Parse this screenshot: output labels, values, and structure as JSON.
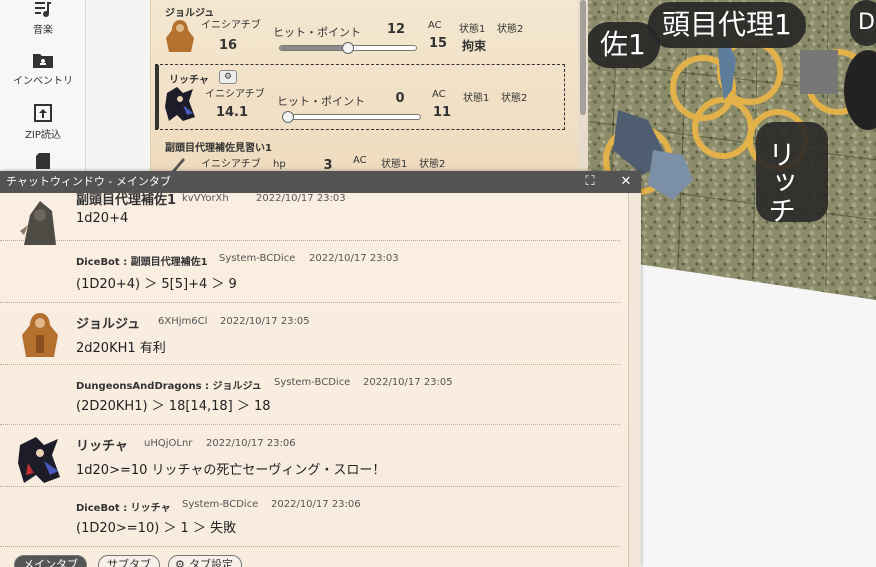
{
  "sidebar": {
    "items": [
      {
        "label": "音楽",
        "icon": "music-icon"
      },
      {
        "label": "インベントリ",
        "icon": "folder-icon"
      },
      {
        "label": "ZIP読込",
        "icon": "upload-icon"
      },
      {
        "label": "",
        "icon": "sd-card-icon"
      }
    ]
  },
  "table": {
    "token_labels": [
      "頭目代理1",
      "佐1",
      "D",
      "リッチ"
    ]
  },
  "charlist": {
    "characters": [
      {
        "name": "ジョルジュ",
        "init_label": "イニシアチブ",
        "init": "16",
        "hp_label": "ヒット・ポイント",
        "hp": "12",
        "ac_label": "AC",
        "ac": "15",
        "status1": "状態1",
        "status2": "状態2",
        "status_value": "拘束",
        "hp_ratio": 0.5
      },
      {
        "name": "リッチャ",
        "init_label": "イニシアチブ",
        "init": "14.1",
        "hp_label": "ヒット・ポイント",
        "hp": "0",
        "ac_label": "AC",
        "ac": "11",
        "status1": "状態1",
        "status2": "状態2",
        "status_value": "",
        "hp_ratio": 0
      },
      {
        "name": "副頭目代理補佐見習い1",
        "init_label": "イニシアチブ",
        "init": "",
        "hp_label": "hp",
        "hp": "3",
        "ac_label": "AC",
        "ac": "",
        "status1": "状態1",
        "status2": "状態2",
        "status_value": "",
        "hp_ratio": 0
      }
    ]
  },
  "chat": {
    "title": "チャットウィンドウ - メインタブ",
    "expand_icon": "⛶",
    "close_icon": "✕",
    "messages": [
      {
        "who": "副頭目代理補佐1",
        "id": "kvVYorXh",
        "time": "2022/10/17 23:03",
        "text": "1d20+4"
      },
      {
        "who": "DiceBot : 副頭目代理補佐1",
        "id": "System-BCDice",
        "time": "2022/10/17 23:03",
        "text": "(1D20+4) ＞ 5[5]+4 ＞ 9"
      },
      {
        "who": "ジョルジュ",
        "id": "6XHjm6Cl",
        "time": "2022/10/17 23:05",
        "text": "2d20KH1 有利"
      },
      {
        "who": "DungeonsAndDragons : ジョルジュ",
        "id": "System-BCDice",
        "time": "2022/10/17 23:05",
        "text": "(2D20KH1) ＞ 18[14,18] ＞ 18"
      },
      {
        "who": "リッチャ",
        "id": "uHQjOLnr",
        "time": "2022/10/17 23:06",
        "text": "1d20>=10 リッチャの死亡セーヴィング・スロー！"
      },
      {
        "who": "DiceBot : リッチャ",
        "id": "System-BCDice",
        "time": "2022/10/17 23:06",
        "text": "(1D20>=10) ＞ 1 ＞ 失敗"
      }
    ],
    "tabs": [
      "メインタブ",
      "サブタブ",
      "タブ設定"
    ]
  }
}
